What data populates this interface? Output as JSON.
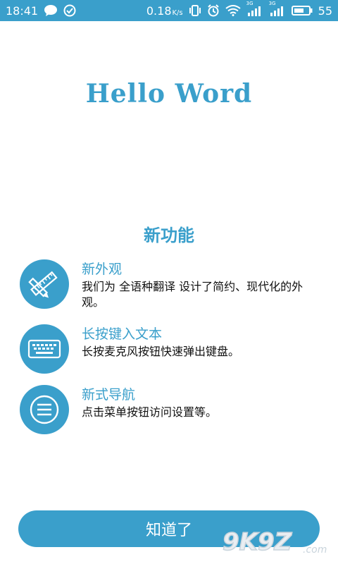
{
  "status_bar": {
    "time": "18:41",
    "speed_value": "0.18",
    "speed_unit": "K/s",
    "sim1_label": "3G",
    "sim2_label": "3G",
    "battery": "55"
  },
  "app_title": "Hello Word",
  "section_title": "新功能",
  "features": [
    {
      "icon": "pencil-ruler-icon",
      "title": "新外观",
      "desc": "我们为 全语种翻译 设计了简约、现代化的外观。"
    },
    {
      "icon": "keyboard-icon",
      "title": "长按键入文本",
      "desc": "长按麦克风按钮快速弹出键盘。"
    },
    {
      "icon": "menu-icon",
      "title": "新式导航",
      "desc": "点击菜单按钮访问设置等。"
    }
  ],
  "confirm_button_label": "知道了",
  "watermark_text": "9K9Z",
  "watermark_suffix": ".com",
  "colors": {
    "accent": "#3a9fcb",
    "text": "#111111",
    "background": "#ffffff"
  }
}
